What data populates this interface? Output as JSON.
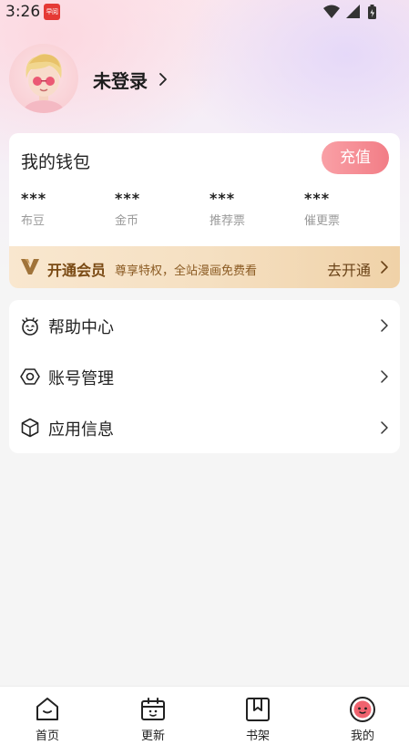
{
  "status_bar": {
    "time": "3:26",
    "app_badge": "早阅"
  },
  "profile": {
    "login_label": "未登录"
  },
  "wallet": {
    "title": "我的钱包",
    "recharge_label": "充值",
    "stats": [
      {
        "value": "***",
        "label": "布豆"
      },
      {
        "value": "***",
        "label": "金币"
      },
      {
        "value": "***",
        "label": "推荐票"
      },
      {
        "value": "***",
        "label": "催更票"
      }
    ]
  },
  "vip": {
    "title": "开通会员",
    "description": "尊享特权，全站漫画免费看",
    "action_label": "去开通"
  },
  "menu": {
    "items": [
      {
        "label": "帮助中心",
        "icon": "help-face-icon"
      },
      {
        "label": "账号管理",
        "icon": "hexagon-settings-icon"
      },
      {
        "label": "应用信息",
        "icon": "cube-icon"
      }
    ]
  },
  "tabbar": {
    "tabs": [
      {
        "label": "首页",
        "icon": "home-icon"
      },
      {
        "label": "更新",
        "icon": "calendar-icon"
      },
      {
        "label": "书架",
        "icon": "bookshelf-icon"
      },
      {
        "label": "我的",
        "icon": "profile-face-icon",
        "active": true
      }
    ]
  },
  "colors": {
    "recharge_gradient": [
      "#f9a0a6",
      "#f27d86"
    ],
    "vip_text": "#7a4a14",
    "active_tab": "#f0636f"
  }
}
